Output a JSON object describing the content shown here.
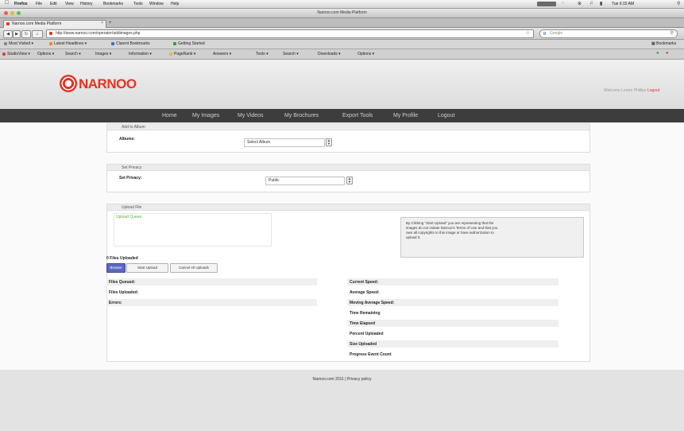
{
  "menubar": {
    "items": [
      "Firefox",
      "File",
      "Edit",
      "View",
      "History",
      "Bookmarks",
      "Tools",
      "Window",
      "Help"
    ],
    "clock": "Tue 6:15 AM"
  },
  "window": {
    "title": "Narnoo.com Media Platform"
  },
  "tab": {
    "label": "Narnoo.com Media Platform"
  },
  "navbar": {
    "url": "http://www.narnoo.com/operator/addimages.php",
    "search_placeholder": "Google"
  },
  "bookmarks": {
    "items": [
      "Most Visited",
      "Latest Headlines",
      "Clarent Bookmarks",
      "Getting Started"
    ]
  },
  "toolbar2": {
    "items": [
      "StudioView",
      "Options",
      "Search",
      "Images",
      "Information",
      "PageRank",
      "Answers",
      "Tools",
      "Search",
      "Downloads",
      "Options"
    ]
  },
  "site": {
    "logo": "NARNOO",
    "login_prefix": "Welcome Lorem Phillips",
    "login_link": "Logout",
    "nav": [
      "Home",
      "My Images",
      "My Videos",
      "My Brochures",
      "Export Tools",
      "My Profile",
      "Logout"
    ],
    "footer": "Narnoo.com 2011 | Privacy policy"
  },
  "album_panel": {
    "header": "Add to Album",
    "label": "Albums:",
    "selected": "Select Album"
  },
  "privacy_panel": {
    "header": "Set Privacy",
    "label": "Set Privacy:",
    "selected": "Public"
  },
  "upload_panel": {
    "header": "Upload File",
    "queue_label": "Upload Queue",
    "notice": "By Clicking \"Start Upload\" you are representing that the images do not violate Narnoo's Terms of Use and that you own all copyrights to this image or have authorization to upload it.",
    "files_uploaded": "0 Files Uploaded",
    "buttons": [
      "Browse",
      "Start Upload",
      "Cancel All Uploads"
    ],
    "stats_left": [
      "Files Queued:",
      "Files Uploaded:",
      "Errors:"
    ],
    "stats_right": [
      "Current Speed:",
      "Average Speed:",
      "Moving Average Speed:",
      "Time Remaining",
      "Time Elapsed",
      "Percent Uploaded",
      "Size Uploaded",
      "Progress Event Count"
    ]
  },
  "colors": {
    "brand": "#e8311f",
    "nav_bg": "#3d3d3d",
    "button_primary": "#5b68c0",
    "queue_text": "#5cb03b"
  }
}
